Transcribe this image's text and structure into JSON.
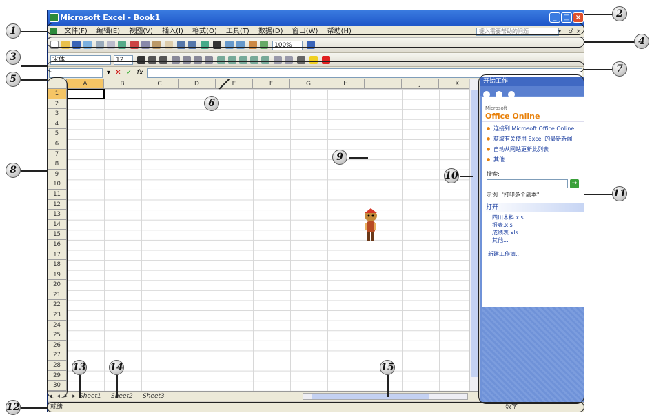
{
  "window": {
    "title": "Microsoft Excel - Book1",
    "buttons": {
      "minimize": "_",
      "restore": "□",
      "close": "×"
    }
  },
  "menubar": {
    "items": [
      "文件(F)",
      "编辑(E)",
      "视图(V)",
      "插入(I)",
      "格式(O)",
      "工具(T)",
      "数据(D)",
      "窗口(W)",
      "帮助(H)"
    ],
    "help_placeholder": "键入需要帮助的问题",
    "doc_controls": "▾ _ ♂ ×"
  },
  "toolbars": {
    "zoom": "100%",
    "font": "宋体",
    "font_size": "12"
  },
  "formula_bar": {
    "name_box": "",
    "icons": [
      "▾",
      "✕",
      "✓",
      "fx"
    ],
    "content": ""
  },
  "grid": {
    "columns": [
      "A",
      "B",
      "C",
      "D",
      "E",
      "F",
      "G",
      "H",
      "I",
      "J",
      "K"
    ],
    "rows": [
      "1",
      "2",
      "3",
      "4",
      "5",
      "6",
      "7",
      "8",
      "9",
      "10",
      "11",
      "12",
      "13",
      "14",
      "15",
      "16",
      "17",
      "18",
      "19",
      "20",
      "21",
      "22",
      "23",
      "24",
      "25",
      "26",
      "27",
      "28",
      "29",
      "30"
    ],
    "active_cell": "A1"
  },
  "task_pane": {
    "title": "开始工作",
    "logo_small": "Microsoft",
    "logo_main": "Office Online",
    "links": [
      "连接到 Microsoft Office Online",
      "获取有关使用 Excel 的最新新闻",
      "自动从网站更新此列表",
      "其他..."
    ],
    "search_label": "搜索:",
    "search_go": "→",
    "example": "示例: \"打印多个副本\"",
    "open_title": "打开",
    "files": [
      "四川木料.xls",
      "报表.xls",
      "成绩表.xls",
      "其他..."
    ],
    "new_workbook": "新建工作簿..."
  },
  "sheet_tabs": {
    "nav": "◂ ◂ ▸ ▸",
    "tabs": [
      "Sheet1",
      "Sheet2",
      "Sheet3"
    ]
  },
  "statusbar": {
    "left": "就绪",
    "right": "数字"
  },
  "callouts": [
    "1",
    "2",
    "3",
    "4",
    "5",
    "6",
    "7",
    "8",
    "9",
    "10",
    "11",
    "12",
    "13",
    "14",
    "15"
  ]
}
